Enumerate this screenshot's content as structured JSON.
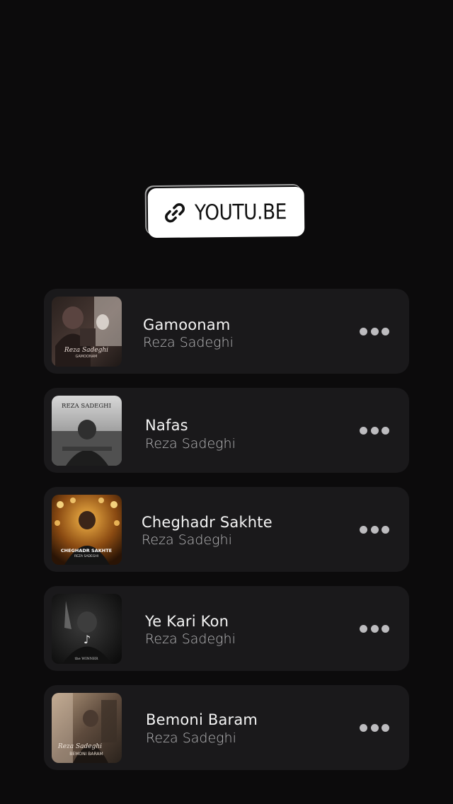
{
  "link_sticker": {
    "icon": "link-icon",
    "text": "YOUTU.BE"
  },
  "tracks": [
    {
      "title": "Gamoonam",
      "artist": "Reza Sadeghi",
      "cover_text": [
        "Reza Sadeghi",
        "GAMOONAM"
      ],
      "more_icon": "more-horizontal-icon"
    },
    {
      "title": "Nafas",
      "artist": "Reza Sadeghi",
      "cover_text": [
        "REZA SADEGHI"
      ],
      "more_icon": "more-horizontal-icon"
    },
    {
      "title": "Cheghadr Sakhte",
      "artist": "Reza Sadeghi",
      "cover_text": [
        "CHEGHADR SAKHTE",
        "REZA SADEGHI"
      ],
      "more_icon": "more-horizontal-icon"
    },
    {
      "title": "Ye Kari Kon",
      "artist": "Reza Sadeghi",
      "cover_text": [
        "the WINNER"
      ],
      "more_icon": "more-horizontal-icon"
    },
    {
      "title": "Bemoni Baram",
      "artist": "Reza Sadeghi",
      "cover_text": [
        "Reza Sadeghi",
        "BEMONI BARAM"
      ],
      "more_icon": "more-horizontal-icon"
    }
  ]
}
